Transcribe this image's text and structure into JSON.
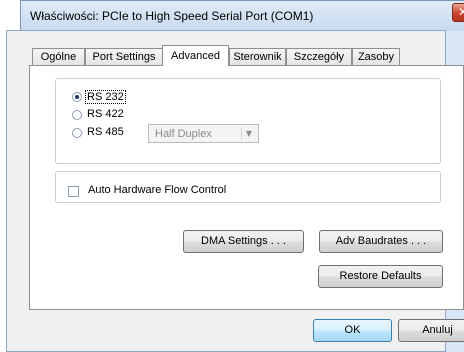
{
  "window": {
    "title": "Właściwości: PCIe to High Speed Serial Port (COM1)",
    "close_glyph": "✕"
  },
  "tabs": [
    {
      "label": "Ogólne",
      "active": false
    },
    {
      "label": "Port Settings",
      "active": false
    },
    {
      "label": "Advanced",
      "active": true
    },
    {
      "label": "Sterownik",
      "active": false
    },
    {
      "label": "Szczegóły",
      "active": false
    },
    {
      "label": "Zasoby",
      "active": false
    }
  ],
  "mode": {
    "options": [
      {
        "label": "RS 232",
        "selected": true
      },
      {
        "label": "RS 422",
        "selected": false
      },
      {
        "label": "RS 485",
        "selected": false
      }
    ],
    "duplex": {
      "value": "Half Duplex",
      "enabled": false
    }
  },
  "flow_control": {
    "label": "Auto Hardware Flow Control",
    "checked": false
  },
  "buttons": {
    "dma": "DMA Settings . . .",
    "baud": "Adv Baudrates . . .",
    "restore": "Restore Defaults",
    "ok": "OK",
    "cancel": "Anuluj"
  }
}
